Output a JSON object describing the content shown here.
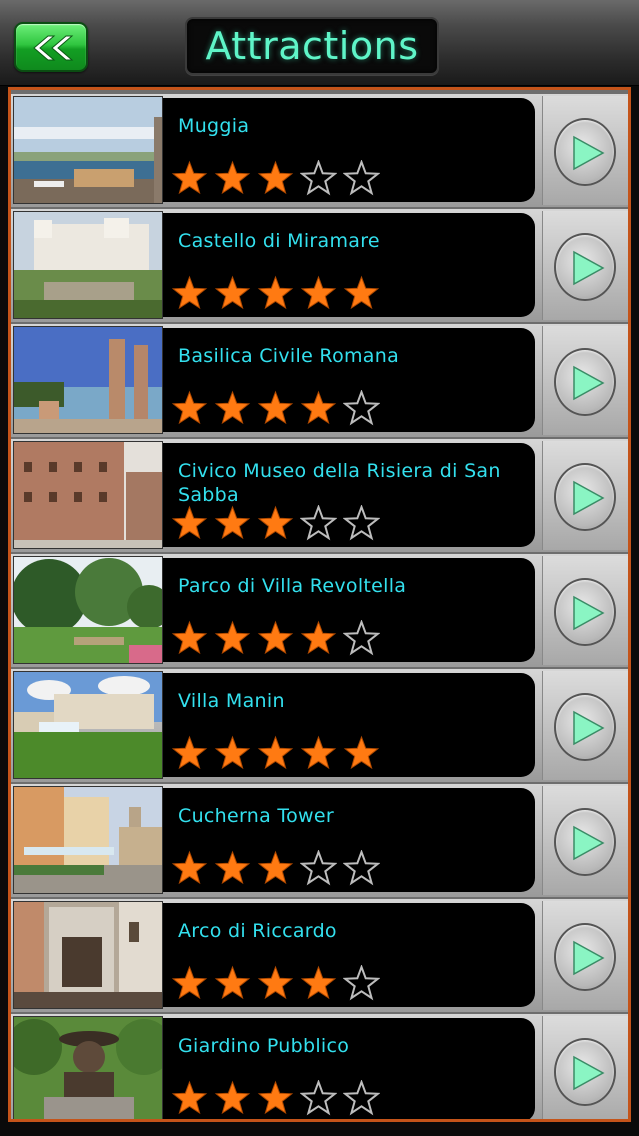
{
  "header": {
    "title": "Attractions",
    "back_icon": "double-chevron-left-icon"
  },
  "colors": {
    "accent_green": "#2fc53f",
    "title_teal": "#5ff5c8",
    "name_cyan": "#33e0ee",
    "star_orange": "#ff7a12",
    "list_border": "#c4541a"
  },
  "attractions": [
    {
      "name": "Muggia",
      "rating": 3
    },
    {
      "name": "Castello di Miramare",
      "rating": 5
    },
    {
      "name": "Basilica Civile Romana",
      "rating": 4
    },
    {
      "name": "Civico Museo della Risiera di San Sabba",
      "rating": 3
    },
    {
      "name": "Parco di Villa Revoltella",
      "rating": 4
    },
    {
      "name": "Villa Manin",
      "rating": 5
    },
    {
      "name": "Cucherna Tower",
      "rating": 3
    },
    {
      "name": "Arco di Riccardo",
      "rating": 4
    },
    {
      "name": "Giardino Pubblico",
      "rating": 3
    }
  ],
  "rating_max": 5,
  "row_icon": "play-arrow-icon"
}
